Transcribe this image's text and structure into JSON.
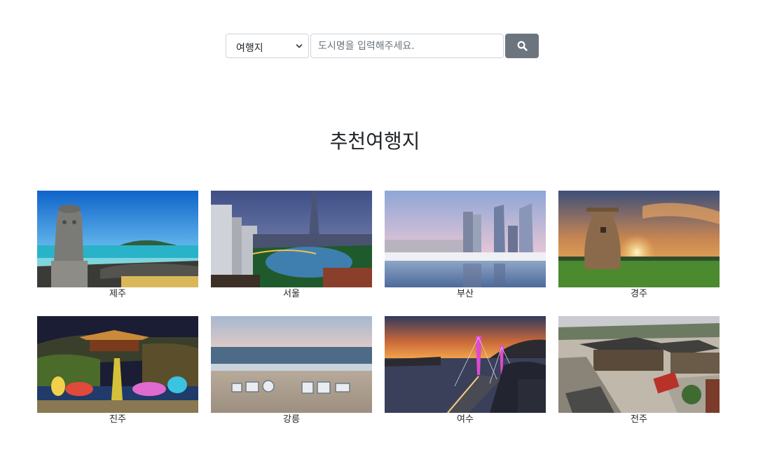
{
  "search": {
    "select_value": "여행지",
    "placeholder": "도시명을 입력해주세요."
  },
  "section": {
    "title": "추천여행지"
  },
  "destinations": [
    {
      "name": "제주"
    },
    {
      "name": "서울"
    },
    {
      "name": "부산"
    },
    {
      "name": "경주"
    },
    {
      "name": "진주"
    },
    {
      "name": "강릉"
    },
    {
      "name": "여수"
    },
    {
      "name": "전주"
    }
  ],
  "colors": {
    "button": "#6c757d",
    "border": "#ced4da"
  }
}
